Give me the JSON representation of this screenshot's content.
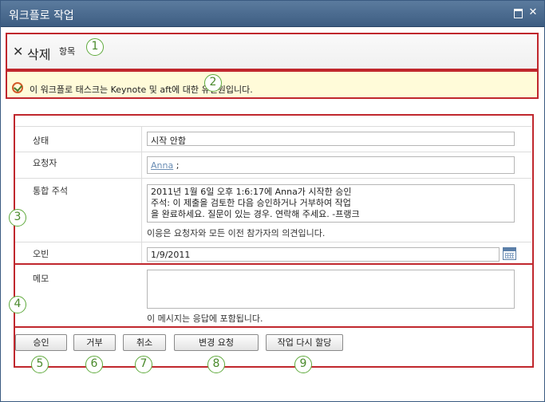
{
  "window": {
    "title": "워크플로 작업"
  },
  "ribbon": {
    "delete_label": "삭제",
    "delete_sub": "항목"
  },
  "infobar": {
    "message": "이 워크플로 태스크는 Keynote 및 aft에 대한 유인원입니다."
  },
  "form": {
    "status": {
      "label": "상태",
      "value": "시작 안함"
    },
    "requester": {
      "label": "요청자",
      "name": "Anna",
      "suffix": ";"
    },
    "consolidated": {
      "label": "통합 주석",
      "lines": [
        "2011년 1월 6일 오후 1:6:17에 Anna가 시작한 승인",
        "주석: 이 제출을 검토한 다음 승인하거나 거부하여 작업",
        "을 완료하세요. 질문이 있는 경우. 연락해 주세요. -프랭크"
      ],
      "hint": "이응은 요청자와 모든 이전 참가자의 의견입니다."
    },
    "due": {
      "label": "오빈",
      "value": "1/9/2011"
    },
    "comments": {
      "label": "메모",
      "value": "",
      "hint": "이 메시지는 응답에 포함됩니다."
    }
  },
  "buttons": {
    "approve": "승인",
    "reject": "거부",
    "cancel": "취소",
    "request_change": "변경 요청",
    "reassign": "작업 다시 할당"
  },
  "callouts": [
    "1",
    "2",
    "3",
    "4",
    "5",
    "6",
    "7",
    "8",
    "9"
  ],
  "colors": {
    "callout_border": "#c0272d",
    "callout_circle": "#5faa3c",
    "titlebar": "#4a6a90",
    "infobar_bg": "#fffbd9"
  }
}
